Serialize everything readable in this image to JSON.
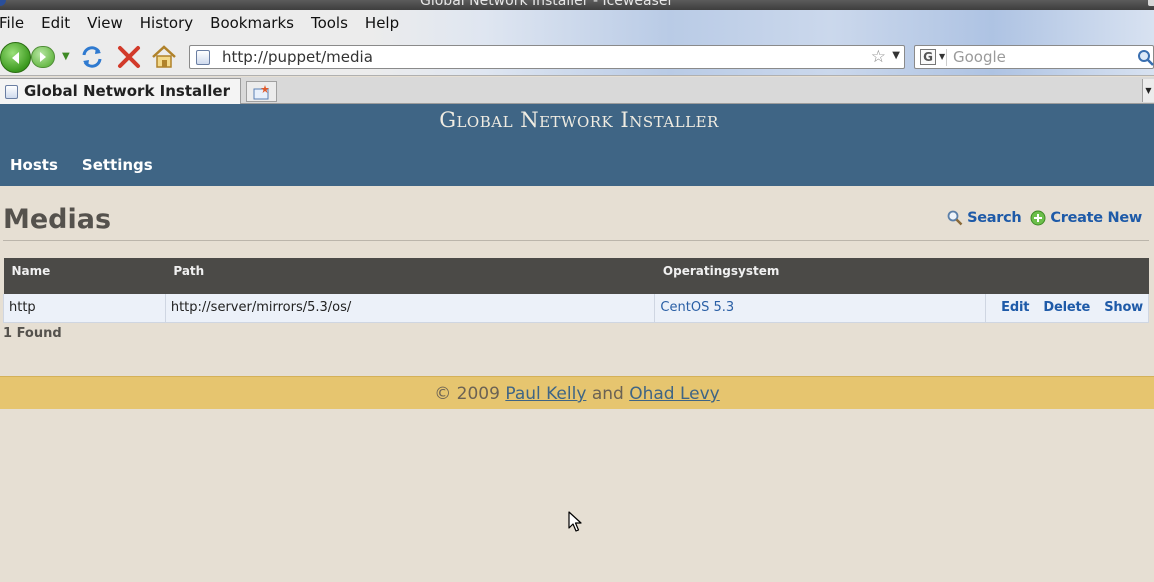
{
  "window": {
    "title": "Global Network Installer - Iceweasel"
  },
  "menubar": {
    "items": [
      "File",
      "Edit",
      "View",
      "History",
      "Bookmarks",
      "Tools",
      "Help"
    ]
  },
  "navigation": {
    "url": "http://puppet/media",
    "search_placeholder": "Google"
  },
  "tabs": [
    {
      "label": "Global Network Installer"
    }
  ],
  "site": {
    "title": "Global Network Installer",
    "nav": [
      "Hosts",
      "Settings"
    ]
  },
  "page": {
    "title": "Medias",
    "actions": {
      "search": "Search",
      "create": "Create New"
    },
    "table": {
      "columns": [
        "Name",
        "Path",
        "Operatingsystem"
      ],
      "rows": [
        {
          "name": "http",
          "path": "http://server/mirrors/5.3/os/",
          "os": "CentOS 5.3",
          "actions": [
            "Edit",
            "Delete",
            "Show"
          ]
        }
      ]
    },
    "found": "1 Found"
  },
  "footer": {
    "copyright": "© 2009",
    "author1": "Paul Kelly",
    "conj": "and",
    "author2": "Ohad Levy"
  },
  "colors": {
    "header": "#3f6585",
    "footer": "#e6c56f",
    "background": "#e6dfd3",
    "link": "#1e5aa8"
  },
  "icons": [
    "back-icon",
    "forward-icon",
    "reload-icon",
    "stop-icon",
    "home-icon",
    "star-icon",
    "search-icon",
    "add-icon"
  ]
}
